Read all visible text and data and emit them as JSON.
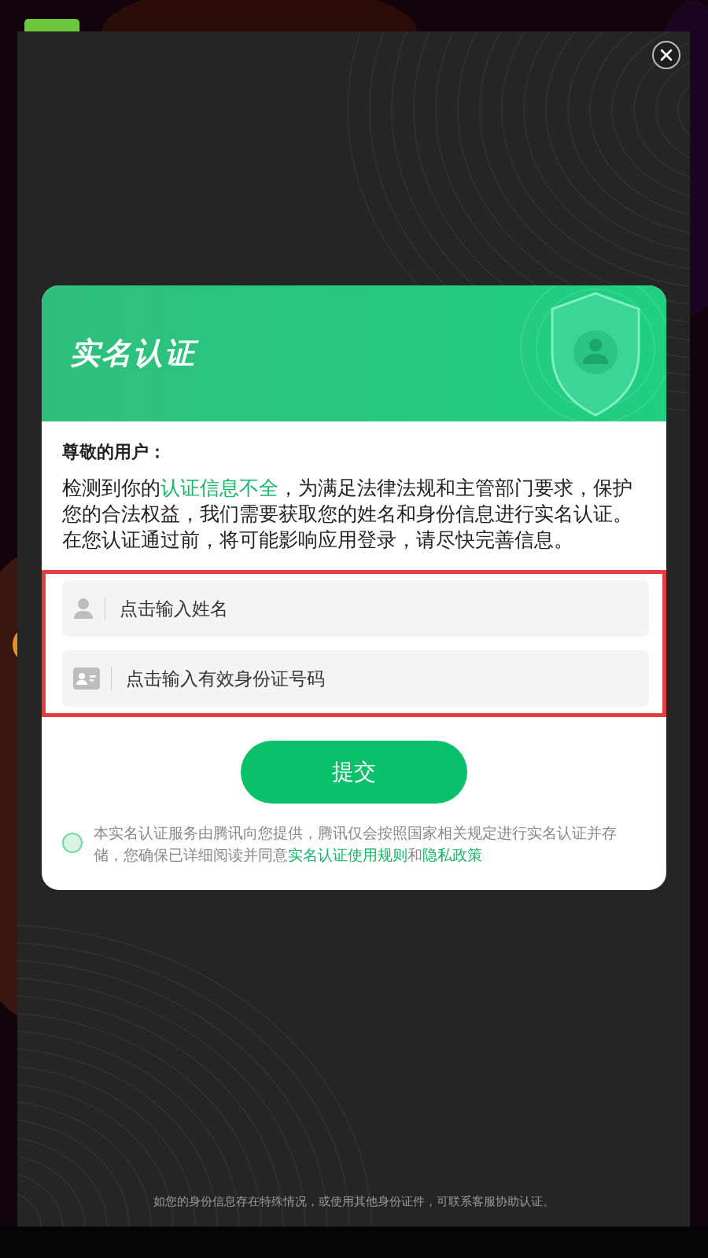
{
  "dialog": {
    "title": "实名认证",
    "greeting": "尊敬的用户：",
    "message": [
      {
        "text": "检测到你的",
        "highlight": false
      },
      {
        "text": "认证信息不全",
        "highlight": true
      },
      {
        "text": "，为满足法律法规和主管部门要求，保护您的合法权益，我们需要获取您的姓名和身份信息进行实名认证。在您认证通过前，将可能影响应用登录，请尽快完善信息。",
        "highlight": false
      }
    ],
    "fields": [
      {
        "kind": "name",
        "placeholder": "点击输入姓名"
      },
      {
        "kind": "id",
        "placeholder": "点击输入有效身份证号码"
      }
    ],
    "submit": "提交",
    "agreement": {
      "checked": false,
      "text": "本实名认证服务由腾讯向您提供，腾讯仅会按照国家相关规定进行实名认证并存储，您确保已详细阅读并同意",
      "links": [
        {
          "text": "实名认证使用规则"
        },
        {
          "text": "隐私政策"
        }
      ],
      "joiner": "和"
    }
  },
  "footer_note": "如您的身份信息存在特殊情况，或使用其他身份证件，可联系客服协助认证。"
}
